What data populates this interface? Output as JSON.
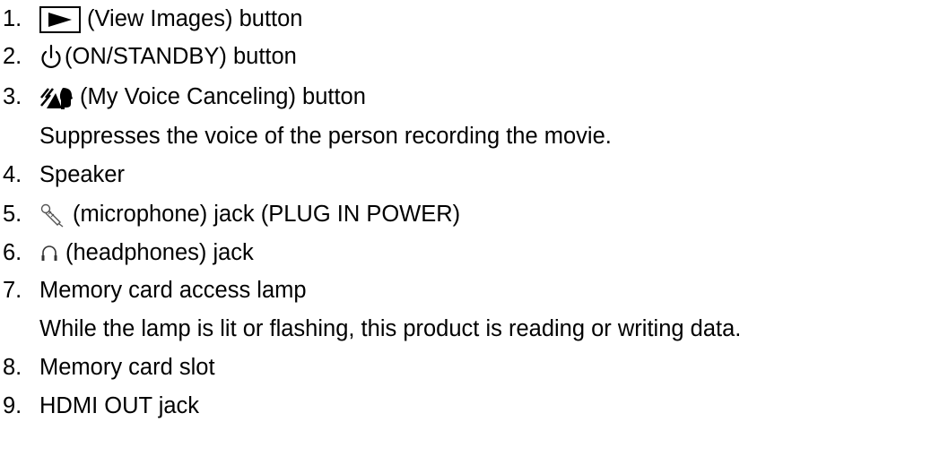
{
  "items": [
    {
      "number": "1.",
      "icon": "play-triangle-icon",
      "text": "(View Images) button"
    },
    {
      "number": "2.",
      "icon": "power-icon",
      "text": "(ON/STANDBY) button"
    },
    {
      "number": "3.",
      "icon": "my-voice-canceling-icon",
      "text": "(My Voice Canceling) button",
      "description": "Suppresses the voice of the person recording the movie."
    },
    {
      "number": "4.",
      "text": "Speaker"
    },
    {
      "number": "5.",
      "icon": "microphone-icon",
      "text": "(microphone) jack (PLUG IN POWER)"
    },
    {
      "number": "6.",
      "icon": "headphones-icon",
      "text": "(headphones) jack"
    },
    {
      "number": "7.",
      "text": "Memory card access lamp",
      "description": "While the lamp is lit or flashing, this product is reading or writing data."
    },
    {
      "number": "8.",
      "text": "Memory card slot"
    },
    {
      "number": "9.",
      "text": "HDMI OUT jack"
    }
  ],
  "colors": {
    "text": "#000000",
    "background": "#ffffff"
  }
}
